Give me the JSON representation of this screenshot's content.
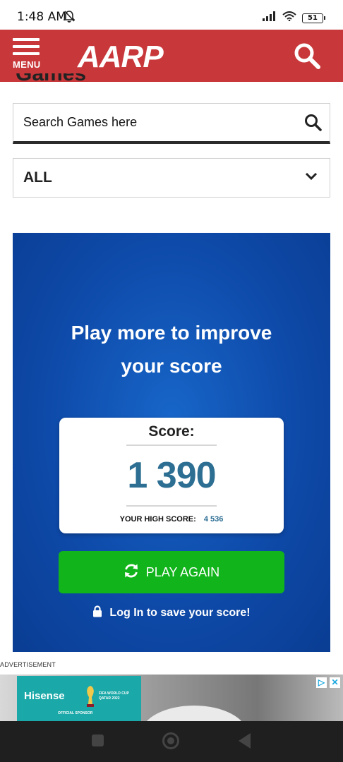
{
  "status_bar": {
    "time": "1:48 AM",
    "battery": "51",
    "icons": [
      "bell-off-icon",
      "signal-icon",
      "wifi-icon",
      "battery-icon"
    ]
  },
  "header": {
    "menu_label": "MENU",
    "logo_text": "AARP",
    "brand_color": "#c8373a"
  },
  "page": {
    "title_peek": "Games"
  },
  "search": {
    "placeholder": "Search Games here"
  },
  "filter": {
    "selected": "ALL"
  },
  "game": {
    "headline_line1": "Play more to improve",
    "headline_line2": "your score",
    "score_label": "Score:",
    "score_value": "1 390",
    "high_score_label": "YOUR HIGH SCORE:",
    "high_score_value": "4 536",
    "play_again_label": "PLAY AGAIN",
    "login_prompt": "Log In to save your score!",
    "panel_color": "#0e4aa9",
    "button_color": "#11b41a",
    "score_color": "#2d6e93"
  },
  "ad": {
    "label": "ADVERTISEMENT",
    "brand": "Hisense",
    "sponsor_text": "OFFICIAL SPONSOR",
    "event_text": "FIFA WORLD CUP QATAR 2022"
  }
}
